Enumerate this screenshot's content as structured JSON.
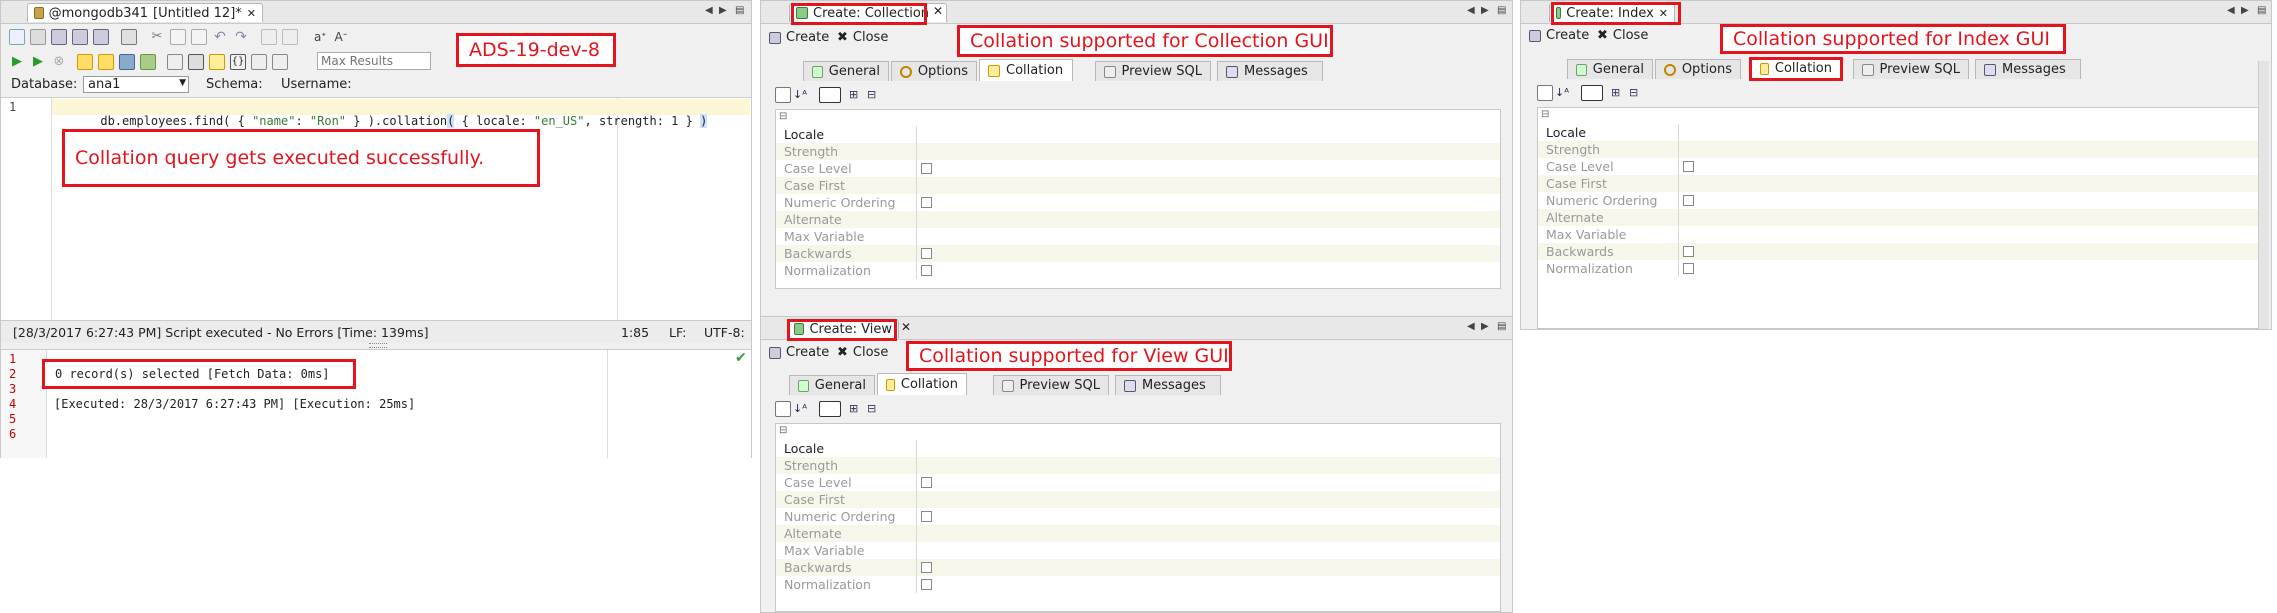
{
  "editor": {
    "tab_title": "@mongodb341",
    "tab_doc": "[Untitled 12]*",
    "max_results_placeholder": "Max Results",
    "database_label": "Database:",
    "database_value": "ana1",
    "schema_label": "Schema:",
    "username_label": "Username:",
    "line_no": "1",
    "query_parts": [
      "db.employees.find( { ",
      "\"name\"",
      ": ",
      "\"Ron\"",
      " } ).collation",
      "(",
      " { ",
      "locale",
      ": ",
      "\"en_US\"",
      ", ",
      "strength",
      ": 1 } ",
      ")"
    ],
    "status_text": "[28/3/2017 6:27:43 PM] Script executed - No Errors [Time: 139ms]",
    "position": "1:85",
    "line_ending": "LF:",
    "encoding": "UTF-8:",
    "output_line_numbers": [
      "1",
      "2",
      "3",
      "4",
      "5",
      "6"
    ],
    "output_line2": "0 record(s) selected [Fetch Data: 0ms]",
    "output_line3": "[Executed: 28/3/2017 6:27:43 PM] [Execution: 25ms]"
  },
  "annotations": {
    "ads": "ADS-19-dev-8",
    "query_success": "Collation query gets executed successfully.",
    "collection": "Collation supported for Collection GUI",
    "index": "Collation supported for Index GUI",
    "view": "Collation supported for View GUI"
  },
  "collection_pane": {
    "tab_title": "Create: Collection",
    "create_label": "Create",
    "close_label": "Close",
    "subtabs": [
      "General",
      "Options",
      "Collation",
      "Preview SQL",
      "Messages"
    ]
  },
  "index_pane": {
    "tab_title": "Create: Index",
    "create_label": "Create",
    "close_label": "Close",
    "subtabs": [
      "General",
      "Options",
      "Collation",
      "Preview SQL",
      "Messages"
    ]
  },
  "view_pane": {
    "tab_title": "Create: View",
    "create_label": "Create",
    "close_label": "Close",
    "subtabs": [
      "General",
      "Collation",
      "Preview SQL",
      "Messages"
    ]
  },
  "collation_props": [
    "Locale",
    "Strength",
    "Case Level",
    "Case First",
    "Numeric Ordering",
    "Alternate",
    "Max Variable",
    "Backwards",
    "Normalization"
  ],
  "colors": {
    "annotation_red": "#e4141c",
    "row_alt": "#f6f6ea",
    "success_check": "#3a9a3a"
  }
}
